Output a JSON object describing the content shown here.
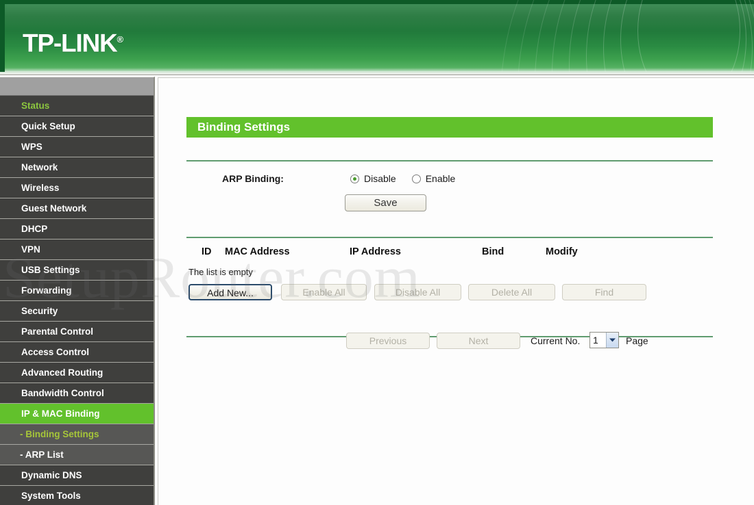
{
  "header": {
    "logo_text": "TP-LINK",
    "logo_mark": "®"
  },
  "watermark": {
    "text": "SetupRouter.com"
  },
  "sidebar": {
    "items": [
      {
        "label": "Status",
        "state": "green-text"
      },
      {
        "label": "Quick Setup",
        "state": "normal"
      },
      {
        "label": "WPS",
        "state": "normal"
      },
      {
        "label": "Network",
        "state": "normal"
      },
      {
        "label": "Wireless",
        "state": "normal"
      },
      {
        "label": "Guest Network",
        "state": "normal"
      },
      {
        "label": "DHCP",
        "state": "normal"
      },
      {
        "label": "VPN",
        "state": "normal"
      },
      {
        "label": "USB Settings",
        "state": "normal"
      },
      {
        "label": "Forwarding",
        "state": "normal"
      },
      {
        "label": "Security",
        "state": "normal"
      },
      {
        "label": "Parental Control",
        "state": "normal"
      },
      {
        "label": "Access Control",
        "state": "normal"
      },
      {
        "label": "Advanced Routing",
        "state": "normal"
      },
      {
        "label": "Bandwidth Control",
        "state": "normal"
      },
      {
        "label": "IP & MAC Binding",
        "state": "active"
      },
      {
        "label": "- Binding Settings",
        "state": "sub-selected"
      },
      {
        "label": "- ARP List",
        "state": "sub"
      },
      {
        "label": "Dynamic DNS",
        "state": "normal"
      },
      {
        "label": "System Tools",
        "state": "normal"
      }
    ]
  },
  "main": {
    "page_title": "Binding Settings",
    "arp_binding": {
      "label": "ARP Binding:",
      "options": [
        {
          "label": "Disable",
          "checked": true
        },
        {
          "label": "Enable",
          "checked": false
        }
      ],
      "save_label": "Save"
    },
    "table": {
      "columns": [
        "ID",
        "MAC Address",
        "IP Address",
        "Bind",
        "Modify"
      ],
      "rows": [],
      "empty_text": "The list is empty"
    },
    "actions": [
      {
        "label": "Add New...",
        "enabled": true
      },
      {
        "label": "Enable All",
        "enabled": false
      },
      {
        "label": "Disable All",
        "enabled": false
      },
      {
        "label": "Delete All",
        "enabled": false
      },
      {
        "label": "Find",
        "enabled": false
      }
    ],
    "pagination": {
      "previous_label": "Previous",
      "previous_enabled": false,
      "next_label": "Next",
      "next_enabled": false,
      "current_label": "Current No.",
      "current_value": "1",
      "page_word": "Page",
      "options": [
        "1"
      ]
    }
  },
  "colors": {
    "brand_green": "#62c12c",
    "header_green": "#2a8b42",
    "sidebar_dark": "#3f3f3d",
    "sidebar_sub": "#575755",
    "accent_text_green": "#8cc63f",
    "divider_green": "#5f9c6f"
  }
}
